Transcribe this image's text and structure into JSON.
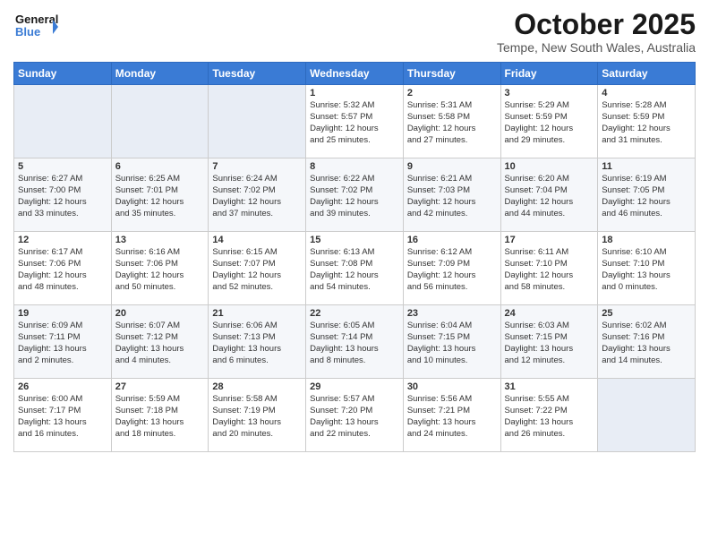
{
  "logo": {
    "line1": "General",
    "line2": "Blue"
  },
  "title": "October 2025",
  "subtitle": "Tempe, New South Wales, Australia",
  "days_header": [
    "Sunday",
    "Monday",
    "Tuesday",
    "Wednesday",
    "Thursday",
    "Friday",
    "Saturday"
  ],
  "weeks": [
    [
      {
        "day": "",
        "info": ""
      },
      {
        "day": "",
        "info": ""
      },
      {
        "day": "",
        "info": ""
      },
      {
        "day": "1",
        "info": "Sunrise: 5:32 AM\nSunset: 5:57 PM\nDaylight: 12 hours\nand 25 minutes."
      },
      {
        "day": "2",
        "info": "Sunrise: 5:31 AM\nSunset: 5:58 PM\nDaylight: 12 hours\nand 27 minutes."
      },
      {
        "day": "3",
        "info": "Sunrise: 5:29 AM\nSunset: 5:59 PM\nDaylight: 12 hours\nand 29 minutes."
      },
      {
        "day": "4",
        "info": "Sunrise: 5:28 AM\nSunset: 5:59 PM\nDaylight: 12 hours\nand 31 minutes."
      }
    ],
    [
      {
        "day": "5",
        "info": "Sunrise: 6:27 AM\nSunset: 7:00 PM\nDaylight: 12 hours\nand 33 minutes."
      },
      {
        "day": "6",
        "info": "Sunrise: 6:25 AM\nSunset: 7:01 PM\nDaylight: 12 hours\nand 35 minutes."
      },
      {
        "day": "7",
        "info": "Sunrise: 6:24 AM\nSunset: 7:02 PM\nDaylight: 12 hours\nand 37 minutes."
      },
      {
        "day": "8",
        "info": "Sunrise: 6:22 AM\nSunset: 7:02 PM\nDaylight: 12 hours\nand 39 minutes."
      },
      {
        "day": "9",
        "info": "Sunrise: 6:21 AM\nSunset: 7:03 PM\nDaylight: 12 hours\nand 42 minutes."
      },
      {
        "day": "10",
        "info": "Sunrise: 6:20 AM\nSunset: 7:04 PM\nDaylight: 12 hours\nand 44 minutes."
      },
      {
        "day": "11",
        "info": "Sunrise: 6:19 AM\nSunset: 7:05 PM\nDaylight: 12 hours\nand 46 minutes."
      }
    ],
    [
      {
        "day": "12",
        "info": "Sunrise: 6:17 AM\nSunset: 7:06 PM\nDaylight: 12 hours\nand 48 minutes."
      },
      {
        "day": "13",
        "info": "Sunrise: 6:16 AM\nSunset: 7:06 PM\nDaylight: 12 hours\nand 50 minutes."
      },
      {
        "day": "14",
        "info": "Sunrise: 6:15 AM\nSunset: 7:07 PM\nDaylight: 12 hours\nand 52 minutes."
      },
      {
        "day": "15",
        "info": "Sunrise: 6:13 AM\nSunset: 7:08 PM\nDaylight: 12 hours\nand 54 minutes."
      },
      {
        "day": "16",
        "info": "Sunrise: 6:12 AM\nSunset: 7:09 PM\nDaylight: 12 hours\nand 56 minutes."
      },
      {
        "day": "17",
        "info": "Sunrise: 6:11 AM\nSunset: 7:10 PM\nDaylight: 12 hours\nand 58 minutes."
      },
      {
        "day": "18",
        "info": "Sunrise: 6:10 AM\nSunset: 7:10 PM\nDaylight: 13 hours\nand 0 minutes."
      }
    ],
    [
      {
        "day": "19",
        "info": "Sunrise: 6:09 AM\nSunset: 7:11 PM\nDaylight: 13 hours\nand 2 minutes."
      },
      {
        "day": "20",
        "info": "Sunrise: 6:07 AM\nSunset: 7:12 PM\nDaylight: 13 hours\nand 4 minutes."
      },
      {
        "day": "21",
        "info": "Sunrise: 6:06 AM\nSunset: 7:13 PM\nDaylight: 13 hours\nand 6 minutes."
      },
      {
        "day": "22",
        "info": "Sunrise: 6:05 AM\nSunset: 7:14 PM\nDaylight: 13 hours\nand 8 minutes."
      },
      {
        "day": "23",
        "info": "Sunrise: 6:04 AM\nSunset: 7:15 PM\nDaylight: 13 hours\nand 10 minutes."
      },
      {
        "day": "24",
        "info": "Sunrise: 6:03 AM\nSunset: 7:15 PM\nDaylight: 13 hours\nand 12 minutes."
      },
      {
        "day": "25",
        "info": "Sunrise: 6:02 AM\nSunset: 7:16 PM\nDaylight: 13 hours\nand 14 minutes."
      }
    ],
    [
      {
        "day": "26",
        "info": "Sunrise: 6:00 AM\nSunset: 7:17 PM\nDaylight: 13 hours\nand 16 minutes."
      },
      {
        "day": "27",
        "info": "Sunrise: 5:59 AM\nSunset: 7:18 PM\nDaylight: 13 hours\nand 18 minutes."
      },
      {
        "day": "28",
        "info": "Sunrise: 5:58 AM\nSunset: 7:19 PM\nDaylight: 13 hours\nand 20 minutes."
      },
      {
        "day": "29",
        "info": "Sunrise: 5:57 AM\nSunset: 7:20 PM\nDaylight: 13 hours\nand 22 minutes."
      },
      {
        "day": "30",
        "info": "Sunrise: 5:56 AM\nSunset: 7:21 PM\nDaylight: 13 hours\nand 24 minutes."
      },
      {
        "day": "31",
        "info": "Sunrise: 5:55 AM\nSunset: 7:22 PM\nDaylight: 13 hours\nand 26 minutes."
      },
      {
        "day": "",
        "info": ""
      }
    ]
  ]
}
